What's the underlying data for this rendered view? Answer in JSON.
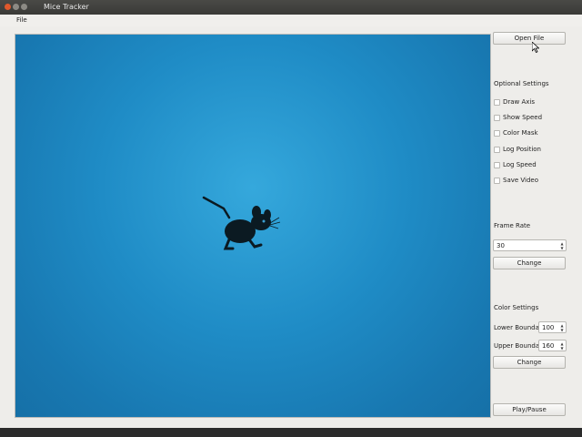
{
  "window": {
    "title": "Mice Tracker"
  },
  "menu": {
    "file": "File"
  },
  "buttons": {
    "open_file": "Open File",
    "play_pause": "Play/Pause"
  },
  "optional_settings": {
    "heading": "Optional Settings",
    "options": [
      {
        "label": "Draw Axis",
        "checked": false
      },
      {
        "label": "Show Speed",
        "checked": false
      },
      {
        "label": "Color Mask",
        "checked": false
      },
      {
        "label": "Log Position",
        "checked": false
      },
      {
        "label": "Log Speed",
        "checked": false
      },
      {
        "label": "Save Video",
        "checked": false
      }
    ]
  },
  "frame_rate": {
    "heading": "Frame Rate",
    "value": "30",
    "change_label": "Change"
  },
  "color_settings": {
    "heading": "Color Settings",
    "lower_label": "Lower Boundary",
    "lower_value": "100",
    "upper_label": "Upper Boundary",
    "upper_value": "160",
    "change_label": "Change"
  },
  "colors": {
    "video_background": "#1f8cc6",
    "close_button": "#e0582c",
    "panel_background": "#eeedea"
  }
}
